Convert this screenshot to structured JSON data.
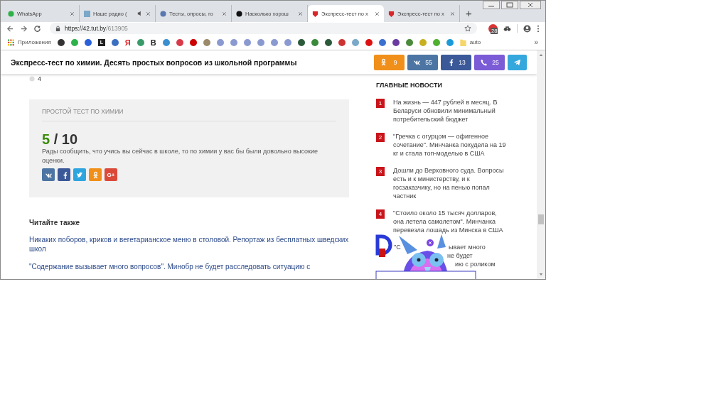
{
  "tabs": [
    {
      "label": "WhatsApp",
      "selected": false,
      "audio": false
    },
    {
      "label": "Наше радио (",
      "selected": false,
      "audio": true
    },
    {
      "label": "Тесты, опросы, го",
      "selected": false,
      "audio": false
    },
    {
      "label": "Насколько хорош",
      "selected": false,
      "audio": false
    },
    {
      "label": "Экспресс-тест по х",
      "selected": true,
      "audio": false
    },
    {
      "label": "Экспресс-тест по х",
      "selected": false,
      "audio": false
    }
  ],
  "new_tab": "+",
  "address": {
    "host": "https://42.tut.by",
    "path": "/613905"
  },
  "extension_badge": "28",
  "bookmarks": [
    {
      "kind": "apps",
      "label": "Приложения"
    },
    {
      "kind": "icon",
      "color": "#333333"
    },
    {
      "kind": "icon",
      "color": "#2fb14a"
    },
    {
      "kind": "icon",
      "color": "#2b5fd9"
    },
    {
      "kind": "tile",
      "label": "L",
      "color": "#222222"
    },
    {
      "kind": "icon",
      "color": "#3b6fc0"
    },
    {
      "kind": "letter",
      "label": "Я",
      "color": "#e02020"
    },
    {
      "kind": "icon",
      "color": "#3a9a6a"
    },
    {
      "kind": "letter",
      "label": "B",
      "color": "#222222"
    },
    {
      "kind": "icon",
      "color": "#3a8fd0"
    },
    {
      "kind": "icon",
      "color": "#d83a4a"
    },
    {
      "kind": "icon",
      "color": "#cc0000"
    },
    {
      "kind": "icon",
      "color": "#9a8a6a"
    },
    {
      "kind": "icon",
      "color": "#8a9ad0"
    },
    {
      "kind": "icon",
      "color": "#8a9ad0"
    },
    {
      "kind": "icon",
      "color": "#8a9ad0"
    },
    {
      "kind": "icon",
      "color": "#8a9ad0"
    },
    {
      "kind": "icon",
      "color": "#8a9ad0"
    },
    {
      "kind": "icon",
      "color": "#8a9ad0"
    },
    {
      "kind": "icon",
      "color": "#2a5a3a"
    },
    {
      "kind": "icon",
      "color": "#3a8a3a"
    },
    {
      "kind": "icon",
      "color": "#2a5a3a"
    },
    {
      "kind": "icon",
      "color": "#cc3333"
    },
    {
      "kind": "icon",
      "color": "#7aa8c8"
    },
    {
      "kind": "icon",
      "color": "#dd1111"
    },
    {
      "kind": "icon",
      "color": "#3a70d0"
    },
    {
      "kind": "icon",
      "color": "#6a3aa0"
    },
    {
      "kind": "icon",
      "color": "#4a8a3a"
    },
    {
      "kind": "icon",
      "color": "#c8b020"
    },
    {
      "kind": "icon",
      "color": "#50b030"
    },
    {
      "kind": "icon",
      "color": "#1a9ad8"
    },
    {
      "kind": "folder",
      "label": "auto"
    }
  ],
  "bookmarks_more": "»",
  "header": {
    "title": "Экспресс-тест по химии. Десять простых вопросов из школьной программы",
    "shares": [
      {
        "kind": "ok",
        "count": "9"
      },
      {
        "kind": "vk",
        "count": "55"
      },
      {
        "kind": "fb",
        "count": "13"
      },
      {
        "kind": "viber",
        "count": "25"
      },
      {
        "kind": "telegram"
      }
    ]
  },
  "partial_option": {
    "label": "4",
    "selected": false
  },
  "result": {
    "caption": "ПРОСТОЙ ТЕСТ ПО ХИМИИ",
    "score": "5",
    "total": "/ 10",
    "text": "Рады сообщить, что учись вы сейчас в школе, то по химии у вас бы были довольно высокие оценки.",
    "shares": [
      {
        "kind": "vk"
      },
      {
        "kind": "fb"
      },
      {
        "kind": "tw"
      },
      {
        "kind": "ok"
      },
      {
        "kind": "gplus",
        "label": "G+"
      }
    ]
  },
  "read_also": {
    "title": "Читайте также",
    "links": [
      "Никаких поборов, криков и вегетарианское меню в столовой. Репортаж из бесплатных шведских школ",
      "\"Содержание вызывает много вопросов\". Минобр не будет расследовать ситуацию с"
    ]
  },
  "news": {
    "title": "ГЛАВНЫЕ НОВОСТИ",
    "items": [
      {
        "number": "1",
        "text": "На жизнь — 447 рублей в месяц. В Беларуси обновили минимальный потребительский бюджет"
      },
      {
        "number": "2",
        "text": "\"Гречка с огурцом — офигенное сочетание\". Минчанка похудела на 19 кг и стала топ-моделью в США"
      },
      {
        "number": "3",
        "text": "Дошли до Верховного суда. Вопросы есть и к министерству, и к госзаказчику, но на пенью попал частник"
      },
      {
        "number": "4",
        "text": "\"Стоило около 15 тысяч долларов, она летела самолетом\". Минчанка перевезла лошадь из Минска в США"
      }
    ],
    "covered_item_lines": [
      "\"С",
      "ывает много",
      "не будет",
      "ию с роликом"
    ]
  }
}
